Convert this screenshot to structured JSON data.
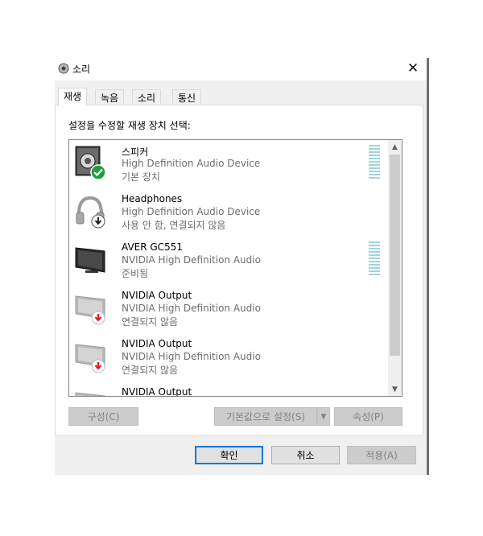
{
  "window": {
    "title": "소리",
    "close_symbol": "✕"
  },
  "tabs": [
    {
      "label": "재생",
      "active": true
    },
    {
      "label": "녹음",
      "active": false
    },
    {
      "label": "소리",
      "active": false
    },
    {
      "label": "통신",
      "active": false
    }
  ],
  "instruction": "설정을 수정할 재생 장치 선택:",
  "devices": [
    {
      "name": "스피커",
      "description": "High Definition Audio Device",
      "status": "기본 장치",
      "icon": "speaker-icon",
      "badge": "default-check"
    },
    {
      "name": "Headphones",
      "description": "High Definition Audio Device",
      "status": "사용 안 함, 연결되지 않음",
      "icon": "headphones-icon",
      "badge": "disabled-arrow"
    },
    {
      "name": "AVER GC551",
      "description": "NVIDIA High Definition Audio",
      "status": "준비됨",
      "icon": "monitor-icon",
      "badge": "none"
    },
    {
      "name": "NVIDIA Output",
      "description": "NVIDIA High Definition Audio",
      "status": "연결되지 않음",
      "icon": "monitor-icon",
      "badge": "disconnected-arrow"
    },
    {
      "name": "NVIDIA Output",
      "description": "NVIDIA High Definition Audio",
      "status": "연결되지 않음",
      "icon": "monitor-icon",
      "badge": "disconnected-arrow"
    },
    {
      "name": "NVIDIA Output",
      "description": "",
      "status": "",
      "icon": "monitor-icon",
      "badge": "none"
    }
  ],
  "buttons": {
    "configure": "구성(C)",
    "set_default": "기본값으로 설정(S)",
    "properties": "속성(P)",
    "ok": "확인",
    "cancel": "취소",
    "apply": "적용(A)"
  },
  "colors": {
    "accent": "#0078d7",
    "check_green": "#1e9e3e",
    "alert_red": "#e02020",
    "meter": "#9fd3e0"
  }
}
